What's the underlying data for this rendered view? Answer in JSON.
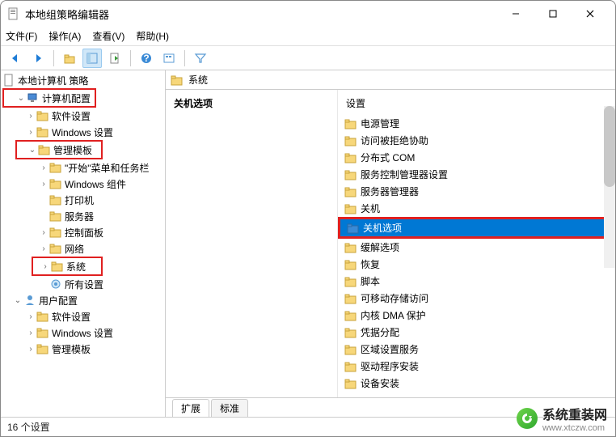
{
  "window": {
    "title": "本地组策略编辑器"
  },
  "menus": {
    "file": "文件(F)",
    "action": "操作(A)",
    "view": "查看(V)",
    "help": "帮助(H)"
  },
  "tree": {
    "root": "本地计算机 策略",
    "computer_config": "计算机配置",
    "software_settings": "软件设置",
    "windows_settings": "Windows 设置",
    "admin_templates": "管理模板",
    "start_menu": "\"开始\"菜单和任务栏",
    "windows_components": "Windows 组件",
    "printers": "打印机",
    "servers": "服务器",
    "control_panel": "控制面板",
    "network": "网络",
    "system": "系统",
    "all_settings": "所有设置",
    "user_config": "用户配置",
    "u_software_settings": "软件设置",
    "u_windows_settings": "Windows 设置",
    "u_admin_templates": "管理模板"
  },
  "path": {
    "current": "系统"
  },
  "columns": {
    "left_head": "关机选项",
    "right_head": "设置"
  },
  "list_items": [
    {
      "label": "电源管理"
    },
    {
      "label": "访问被拒绝协助"
    },
    {
      "label": "分布式 COM"
    },
    {
      "label": "服务控制管理器设置"
    },
    {
      "label": "服务器管理器"
    },
    {
      "label": "关机"
    },
    {
      "label": "关机选项",
      "selected": true
    },
    {
      "label": "缓解选项"
    },
    {
      "label": "恢复"
    },
    {
      "label": "脚本"
    },
    {
      "label": "可移动存储访问"
    },
    {
      "label": "内核 DMA 保护"
    },
    {
      "label": "凭据分配"
    },
    {
      "label": "区域设置服务"
    },
    {
      "label": "驱动程序安装"
    },
    {
      "label": "设备安装"
    }
  ],
  "tabs": {
    "extended": "扩展",
    "standard": "标准"
  },
  "status": {
    "text": "16 个设置"
  },
  "watermark": {
    "text": "系统重装网",
    "url": "www.xtczw.com"
  }
}
